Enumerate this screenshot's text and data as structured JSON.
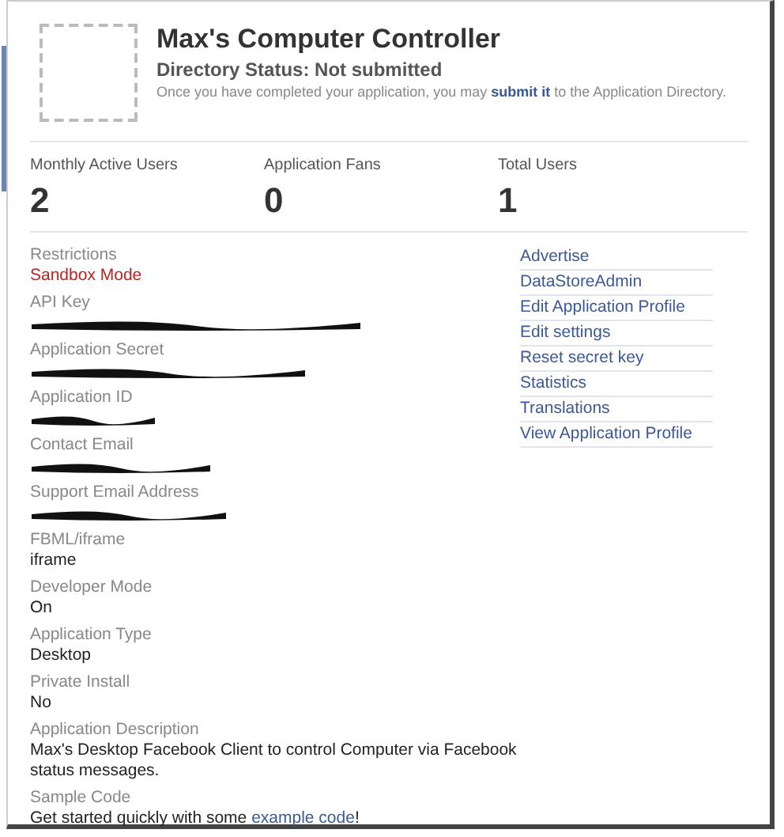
{
  "app": {
    "title": "Max's Computer Controller",
    "directory_status": "Directory Status: Not submitted",
    "note": {
      "before": "Once you have completed your application, you may ",
      "link": "submit it",
      "after": " to the Application Directory."
    }
  },
  "stats": [
    {
      "label": "Monthly Active Users",
      "value": "2"
    },
    {
      "label": "Application Fans",
      "value": "0"
    },
    {
      "label": "Total Users",
      "value": "1"
    }
  ],
  "details": [
    {
      "label": "Restrictions",
      "kind": "warning",
      "value": "Sandbox Mode"
    },
    {
      "label": "API Key",
      "kind": "redacted"
    },
    {
      "label": "Application Secret",
      "kind": "redacted"
    },
    {
      "label": "Application ID",
      "kind": "redacted"
    },
    {
      "label": "Contact Email",
      "kind": "redacted"
    },
    {
      "label": "Support Email Address",
      "kind": "redacted"
    },
    {
      "label": "FBML/iframe",
      "kind": "text",
      "value": "iframe"
    },
    {
      "label": "Developer Mode",
      "kind": "text",
      "value": "On"
    },
    {
      "label": "Application Type",
      "kind": "text",
      "value": "Desktop"
    },
    {
      "label": "Private Install",
      "kind": "text",
      "value": "No"
    },
    {
      "label": "Application Description",
      "kind": "text",
      "value": "Max's Desktop Facebook Client to control Computer via Facebook status messages."
    },
    {
      "label": "Sample Code",
      "kind": "link_text",
      "value": {
        "before": "Get started quickly with some ",
        "link": "example code",
        "after": "!"
      }
    }
  ],
  "actions": [
    "Advertise",
    "DataStoreAdmin",
    "Edit Application Profile",
    "Edit settings",
    "Reset secret key",
    "Statistics",
    "Translations",
    "View Application Profile"
  ]
}
